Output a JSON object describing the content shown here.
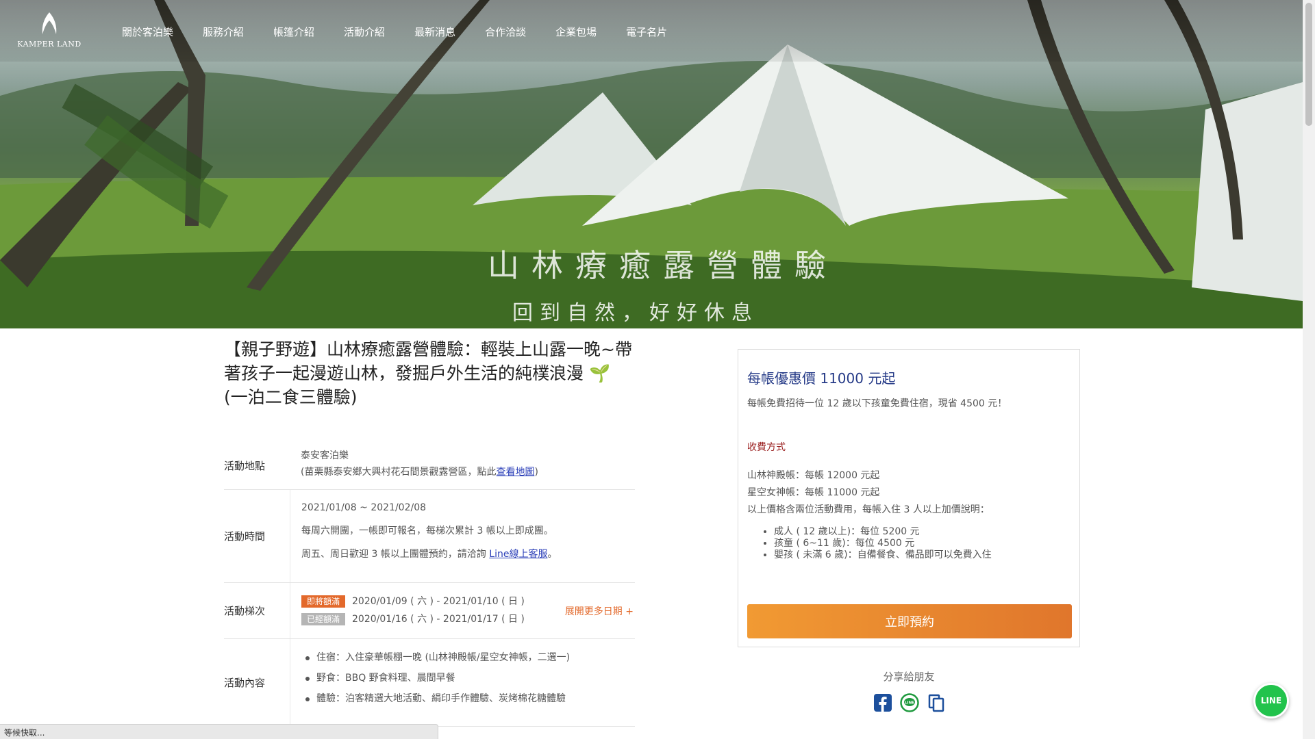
{
  "nav": {
    "logo_text": "KAMPER LAND",
    "items": [
      "關於客泊樂",
      "服務介紹",
      "帳篷介紹",
      "活動介紹",
      "最新消息",
      "合作洽談",
      "企業包場",
      "電子名片"
    ]
  },
  "hero": {
    "title": "山林療癒露營體驗",
    "subtitle": "回到自然，好好休息"
  },
  "event": {
    "title": "【親子野遊】山林療癒露營體驗：輕裝上山露一晚~帶著孩子一起漫遊山林，發掘戶外生活的純樸浪漫 🌱 (一泊二食三體驗)",
    "location_label": "活動地點",
    "location_name": "泰安客泊樂",
    "location_addr_prefix": "(苗栗縣泰安鄉大興村花石間景觀露營區，點此",
    "location_map_link": "查看地圖",
    "location_addr_suffix": ")",
    "time_label": "活動時間",
    "time_range": "2021/01/08 ~ 2021/02/08",
    "time_note1": "每周六開團，一帳即可報名，每梯次累計 3 帳以上即成團。",
    "time_note2_prefix": "周五、周日歡迎 3 帳以上團體預約，請洽詢 ",
    "time_note2_link": "Line線上客服",
    "time_note2_suffix": "。",
    "sessions_label": "活動梯次",
    "sessions": [
      {
        "tag": "即將額滿",
        "date": "2020/01/09 ( 六 ) - 2021/01/10 ( 日 )"
      },
      {
        "tag": "已經額滿",
        "date": "2020/01/16 ( 六 ) - 2021/01/17 ( 日 )"
      }
    ],
    "more_dates": "展開更多日期 +",
    "content_label": "活動內容",
    "content_items": [
      "住宿：入住豪華帳棚一晚 (山林神殿帳/星空女神帳，二選一)",
      "野食：BBQ 野食料理、晨間早餐",
      "體驗：泊客精選大地活動、絹印手作體驗、炭烤棉花糖體驗"
    ]
  },
  "card": {
    "price": "每帳優惠價 11000 元起",
    "note": "每帳免費招待一位 12 歲以下孩童免費住宿，現省 4500 元！",
    "fee_title": "收費方式",
    "fee_lines": [
      "山林神殿帳：每帳 12000 元起",
      "星空女神帳：每帳 11000 元起",
      "以上價格含兩位活動費用，每帳入住 3 人以上加價說明："
    ],
    "fee_items": [
      "成人 ( 12 歲以上)：每位 5200 元",
      "孩童 ( 6~11 歲)：每位 4500 元",
      "嬰孩 ( 未滿 6  歲)：自備餐食、備品即可以免費入住"
    ],
    "book_button": "立即預約"
  },
  "share": {
    "label": "分享給朋友"
  },
  "line_fab": "LINE",
  "status_bar": "等候快取..."
}
